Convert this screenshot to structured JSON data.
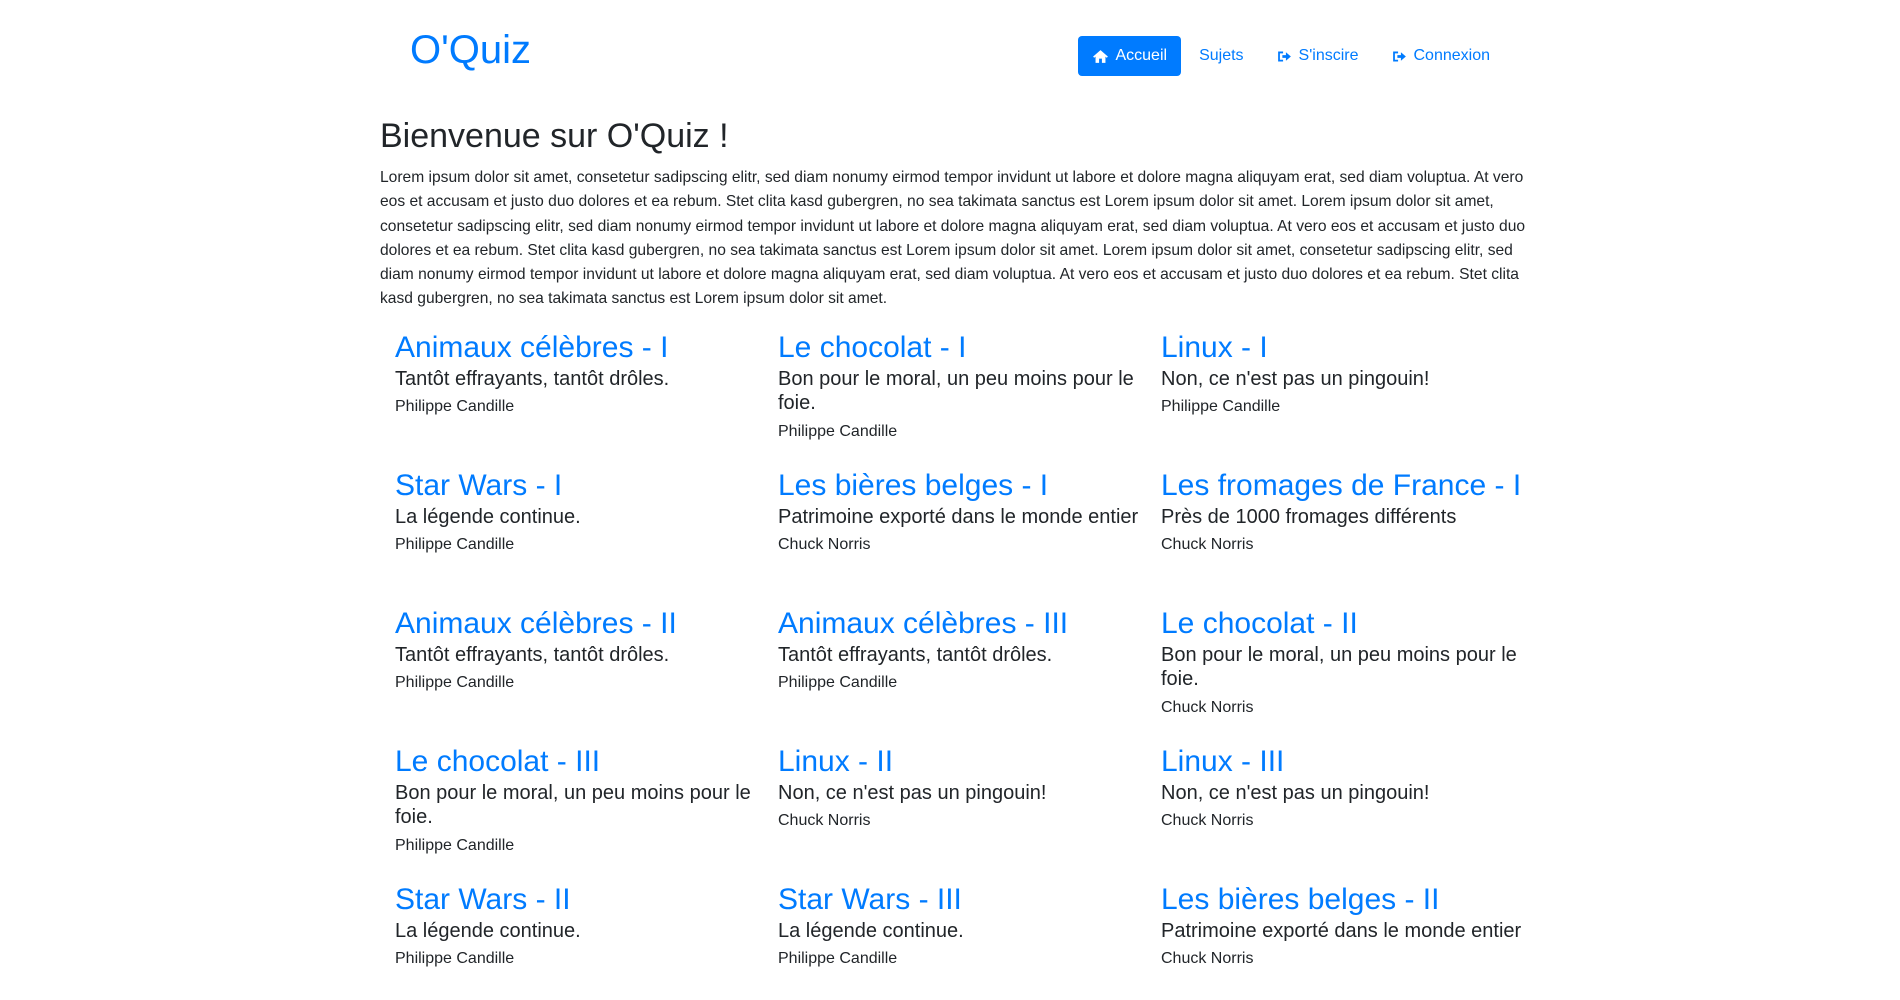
{
  "header": {
    "logo": "O'Quiz",
    "nav": [
      {
        "label": "Accueil",
        "icon": "home-icon",
        "active": true
      },
      {
        "label": "Sujets",
        "icon": "",
        "active": false
      },
      {
        "label": "S'inscire",
        "icon": "sign-in-icon",
        "active": false
      },
      {
        "label": "Connexion",
        "icon": "sign-in-icon",
        "active": false
      }
    ]
  },
  "colors": {
    "accent": "#007bff",
    "text": "#212529",
    "background": "#ffffff"
  },
  "main": {
    "title": "Bienvenue sur O'Quiz !",
    "intro": "Lorem ipsum dolor sit amet, consetetur sadipscing elitr, sed diam nonumy eirmod tempor invidunt ut labore et dolore magna aliquyam erat, sed diam voluptua. At vero eos et accusam et justo duo dolores et ea rebum. Stet clita kasd gubergren, no sea takimata sanctus est Lorem ipsum dolor sit amet. Lorem ipsum dolor sit amet, consetetur sadipscing elitr, sed diam nonumy eirmod tempor invidunt ut labore et dolore magna aliquyam erat, sed diam voluptua. At vero eos et accusam et justo duo dolores et ea rebum. Stet clita kasd gubergren, no sea takimata sanctus est Lorem ipsum dolor sit amet. Lorem ipsum dolor sit amet, consetetur sadipscing elitr, sed diam nonumy eirmod tempor invidunt ut labore et dolore magna aliquyam erat, sed diam voluptua. At vero eos et accusam et justo duo dolores et ea rebum. Stet clita kasd gubergren, no sea takimata sanctus est Lorem ipsum dolor sit amet.",
    "quizzes": [
      {
        "title": "Animaux célèbres - I",
        "description": "Tantôt effrayants, tantôt drôles.",
        "author": "Philippe Candille"
      },
      {
        "title": "Le chocolat - I",
        "description": "Bon pour le moral, un peu moins pour le foie.",
        "author": "Philippe Candille"
      },
      {
        "title": "Linux - I",
        "description": "Non, ce n'est pas un pingouin!",
        "author": "Philippe Candille"
      },
      {
        "title": "Star Wars - I",
        "description": "La légende continue.",
        "author": "Philippe Candille"
      },
      {
        "title": "Les bières belges - I",
        "description": "Patrimoine exporté dans le monde entier",
        "author": "Chuck Norris"
      },
      {
        "title": "Les fromages de France - I",
        "description": "Près de 1000 fromages différents",
        "author": "Chuck Norris"
      },
      {
        "title": "Animaux célèbres - II",
        "description": "Tantôt effrayants, tantôt drôles.",
        "author": "Philippe Candille"
      },
      {
        "title": "Animaux célèbres - III",
        "description": "Tantôt effrayants, tantôt drôles.",
        "author": "Philippe Candille"
      },
      {
        "title": "Le chocolat - II",
        "description": "Bon pour le moral, un peu moins pour le foie.",
        "author": "Chuck Norris"
      },
      {
        "title": "Le chocolat - III",
        "description": "Bon pour le moral, un peu moins pour le foie.",
        "author": "Philippe Candille"
      },
      {
        "title": "Linux - II",
        "description": "Non, ce n'est pas un pingouin!",
        "author": "Chuck Norris"
      },
      {
        "title": "Linux - III",
        "description": "Non, ce n'est pas un pingouin!",
        "author": "Chuck Norris"
      },
      {
        "title": "Star Wars - II",
        "description": "La légende continue.",
        "author": "Philippe Candille"
      },
      {
        "title": "Star Wars - III",
        "description": "La légende continue.",
        "author": "Philippe Candille"
      },
      {
        "title": "Les bières belges - II",
        "description": "Patrimoine exporté dans le monde entier",
        "author": "Chuck Norris"
      }
    ]
  }
}
